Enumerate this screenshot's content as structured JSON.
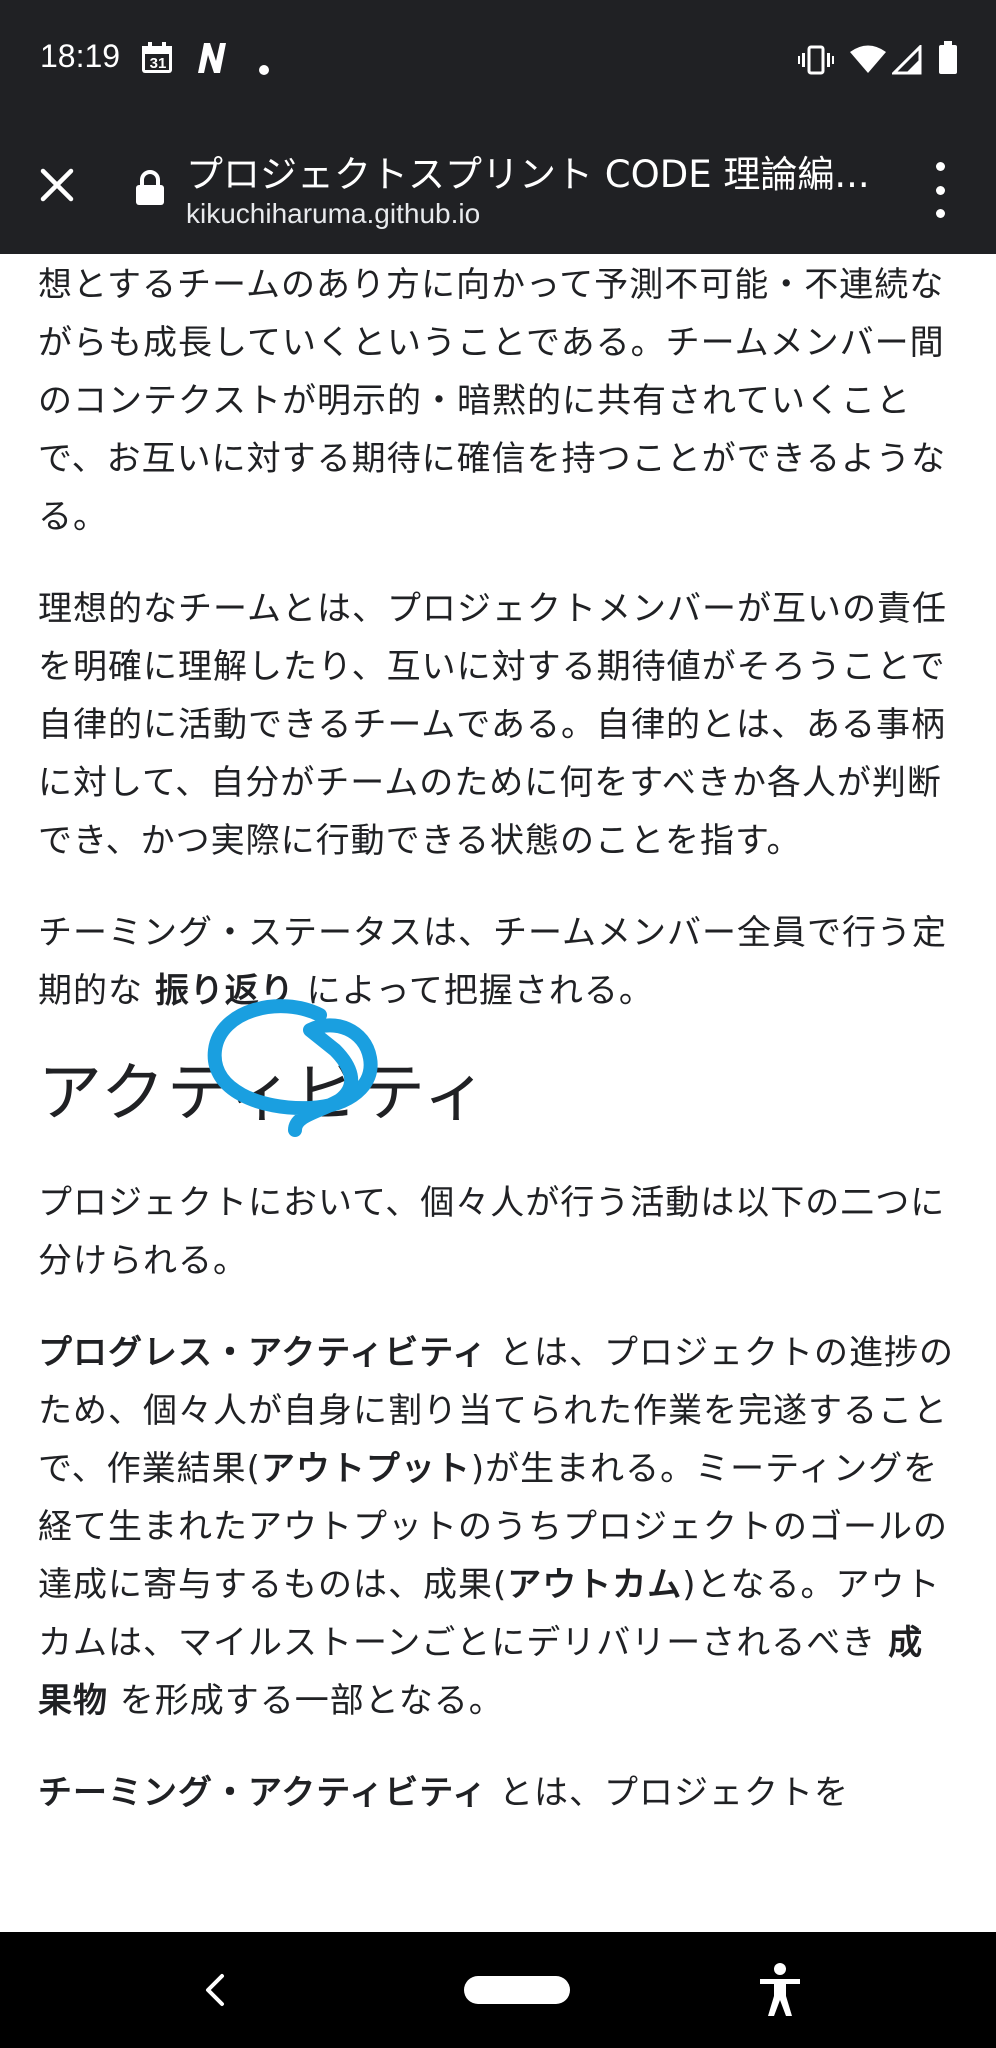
{
  "status_bar": {
    "time": "18:19",
    "calendar_day": "31",
    "icons": [
      "calendar-icon",
      "n-app-icon",
      "notification-dot-icon",
      "vibrate-icon",
      "wifi-icon",
      "signal-icon",
      "battery-icon"
    ]
  },
  "tab_bar": {
    "title": "プロジェクトスプリント CODE 理論編...",
    "url": "kikuchiharuma.github.io"
  },
  "article": {
    "p1": "想とするチームのあり方に向かって予測不可能・不連続ながらも成長していくということである。チームメンバー間のコンテクストが明示的・暗黙的に共有されていくことで、お互いに対する期待に確信を持つことができるようなる。",
    "p2": "理想的なチームとは、プロジェクトメンバーが互いの責任を明確に理解したり、互いに対する期待値がそろうことで自律的に活動できるチームである。自律的とは、ある事柄に対して、自分がチームのために何をすべきか各人が判断でき、かつ実際に行動できる状態のことを指す。",
    "p3_before": "チーミング・ステータスは、チームメンバー全員で行う定期的な ",
    "p3_bold": "振り返り",
    "p3_after": " によって把握される。",
    "heading": "アクティビティ",
    "p4": "プロジェクトにおいて、個々人が行う活動は以下の二つに分けられる。",
    "p5_bold1": "プログレス・アクティビティ",
    "p5_t1": " とは、プロジェクトの進捗のため、個々人が自身に割り当てられた作業を完遂することで、作業結果(",
    "p5_bold2": "アウトプット",
    "p5_t2": ")が生まれる。ミーティングを経て生まれたアウトプットのうちプロジェクトのゴールの達成に寄与するものは、成果(",
    "p5_bold3": "アウトカム",
    "p5_t3": ")となる。アウトカムは、マイルストーンごとにデリバリーされるべき ",
    "p5_bold4": "成果物",
    "p5_t4": " を形成する一部となる。",
    "p6_bold": "チーミング・アクティビティ",
    "p6_t1": " とは、プロジェクトを"
  },
  "colors": {
    "chrome_bg": "#202124",
    "nav_bg": "#000000",
    "annotation": "#1a9fe0",
    "text": "#202124"
  }
}
